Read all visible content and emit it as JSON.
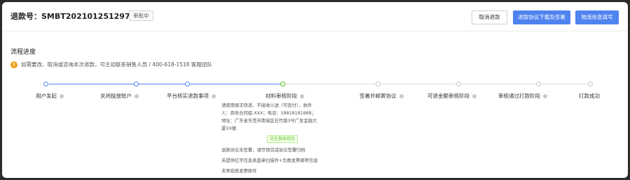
{
  "header": {
    "title": "退款号：SMBT202101251297234",
    "status_badge": "审批中",
    "buttons": {
      "cancel": "取消退款",
      "download": "退款协议下载及签署",
      "logistics": "物流信息填写"
    }
  },
  "progress": {
    "section_title": "流程进度",
    "notice": "如需要改、取消或咨询本次退款，可主动联系销售人员 / 400-618-1518 客服团队",
    "steps": [
      {
        "label": "用户发起",
        "state": "done"
      },
      {
        "label": "关闭投放账户",
        "state": "done"
      },
      {
        "label": "平台核实退款事项",
        "state": "done"
      },
      {
        "label": "材料审核阶段",
        "state": "current"
      },
      {
        "label": "签署并邮寄协议",
        "state": "pending"
      },
      {
        "label": "可退金额审核阶段",
        "state": "pending"
      },
      {
        "label": "审核通过打款阶段",
        "state": "pending"
      },
      {
        "label": "打款成功",
        "state": "pending"
      }
    ],
    "current_detail": {
      "lines": [
        "请使用顺丰快递，不接收以送（可到付），收件",
        "人：商务合同组-XXX；电话：18818181888；",
        "地址：广东省东莞市南城区石竹路3号广发金融大",
        "厦XX楼"
      ],
      "tag": "正在指导待办",
      "todos": [
        "退款协议未签署，请尽快完成协议签署归档",
        "未提供红字信息表盖章扫描件+负数发票邮寄信息",
        "未寄纸质发票原件"
      ]
    }
  },
  "colors": {
    "primary": "#4f83f0",
    "success": "#52c41a",
    "warning": "#f0a020",
    "pending": "#c8c8c8"
  }
}
